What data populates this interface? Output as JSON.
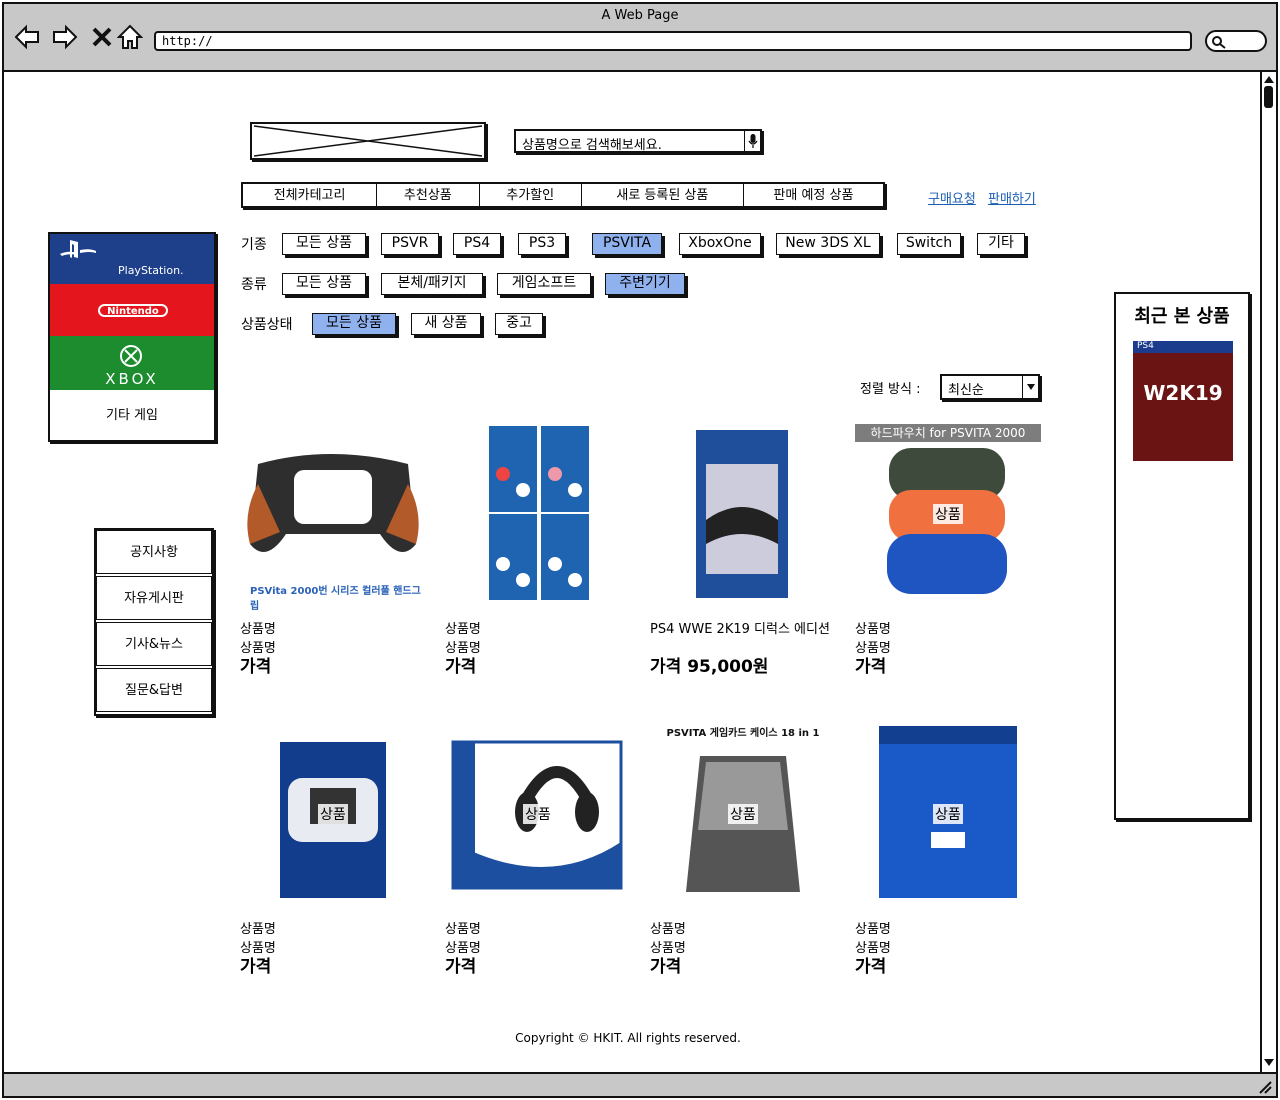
{
  "window": {
    "title": "A Web Page",
    "url": "http://"
  },
  "header": {
    "search_placeholder": "상품명으로 검색해보세요.",
    "tabs": [
      "전체카테고리",
      "추천상품",
      "추가할인",
      "새로 등록된 상품",
      "판매 예정 상품"
    ],
    "links": [
      "구매요청",
      "판매하기"
    ]
  },
  "platforms": [
    {
      "label": "PlayStation.",
      "color": "#1e3f8a"
    },
    {
      "label": "Nintendo",
      "color": "#e4151d"
    },
    {
      "label": "XBOX",
      "color": "#1c8c2e"
    },
    {
      "label": "기타 게임",
      "color": "#ffffff"
    }
  ],
  "side_menu": [
    "공지사항",
    "자유게시판",
    "기사&뉴스",
    "질문&답변"
  ],
  "filters": {
    "machine": {
      "label": "기종",
      "options": [
        "모든 상품",
        "PSVR",
        "PS4",
        "PS3",
        "PSVITA",
        "XboxOne",
        "New 3DS XL",
        "Switch",
        "기타"
      ],
      "selected": "PSVITA"
    },
    "type": {
      "label": "종류",
      "options": [
        "모든 상품",
        "본체/패키지",
        "게임소프트",
        "주변기기"
      ],
      "selected": "주변기기"
    },
    "condition": {
      "label": "상품상태",
      "options": [
        "모든 상품",
        "새 상품",
        "중고"
      ],
      "selected": "모든 상품"
    }
  },
  "sort": {
    "label": "정렬 방식 :",
    "value": "최신순"
  },
  "products": [
    {
      "line1": "상품명",
      "line2": "상품명",
      "price": "가격",
      "caption": "PSVita 2000번 시리즈 컬러풀 핸드그립",
      "overlay": "",
      "banner": ""
    },
    {
      "line1": "상품명",
      "line2": "상품명",
      "price": "가격",
      "caption": "",
      "overlay": "",
      "banner": ""
    },
    {
      "line1": "PS4 WWE 2K19 디럭스 에디션",
      "line2": "",
      "price": "가격 95,000원",
      "caption": "",
      "overlay": "",
      "banner": ""
    },
    {
      "line1": "상품명",
      "line2": "상품명",
      "price": "가격",
      "caption": "",
      "overlay": "상품",
      "banner": "하드파우치 for PSVITA 2000"
    },
    {
      "line1": "상품명",
      "line2": "상품명",
      "price": "가격",
      "caption": "",
      "overlay": "상품",
      "banner": ""
    },
    {
      "line1": "상품명",
      "line2": "상품명",
      "price": "가격",
      "caption": "",
      "overlay": "상품",
      "banner": ""
    },
    {
      "line1": "상품명",
      "line2": "상품명",
      "price": "가격",
      "caption": "PSVITA 게임카드 케이스 18 in 1",
      "overlay": "상품",
      "banner": ""
    },
    {
      "line1": "상품명",
      "line2": "상품명",
      "price": "가격",
      "caption": "",
      "overlay": "상품",
      "banner": ""
    }
  ],
  "recent": {
    "title": "최근 본 상품",
    "item_label": "W2K19",
    "item_tag": "PS4"
  },
  "footer": {
    "copyright": "Copyright © HKIT. All rights reserved."
  }
}
